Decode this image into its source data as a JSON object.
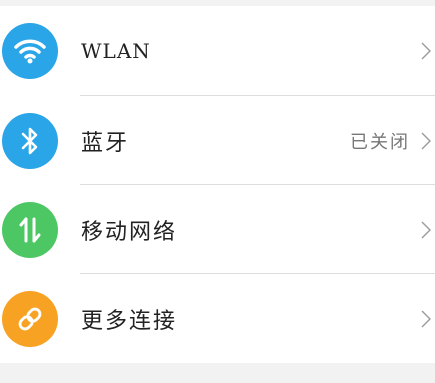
{
  "settings": {
    "items": [
      {
        "label": "WLAN",
        "value": "",
        "icon": "wifi-icon",
        "color": "#2aa5e8"
      },
      {
        "label": "蓝牙",
        "value": "已关闭",
        "icon": "bluetooth-icon",
        "color": "#2aa5e8"
      },
      {
        "label": "移动网络",
        "value": "",
        "icon": "mobile-data-icon",
        "color": "#4cc764"
      },
      {
        "label": "更多连接",
        "value": "",
        "icon": "link-icon",
        "color": "#f8a224"
      }
    ],
    "chevron_icon": "chevron-right-icon",
    "colors": {
      "divider": "#dddddd",
      "background": "#f2f2f2",
      "text": "#222222",
      "value_text": "#777777"
    }
  }
}
